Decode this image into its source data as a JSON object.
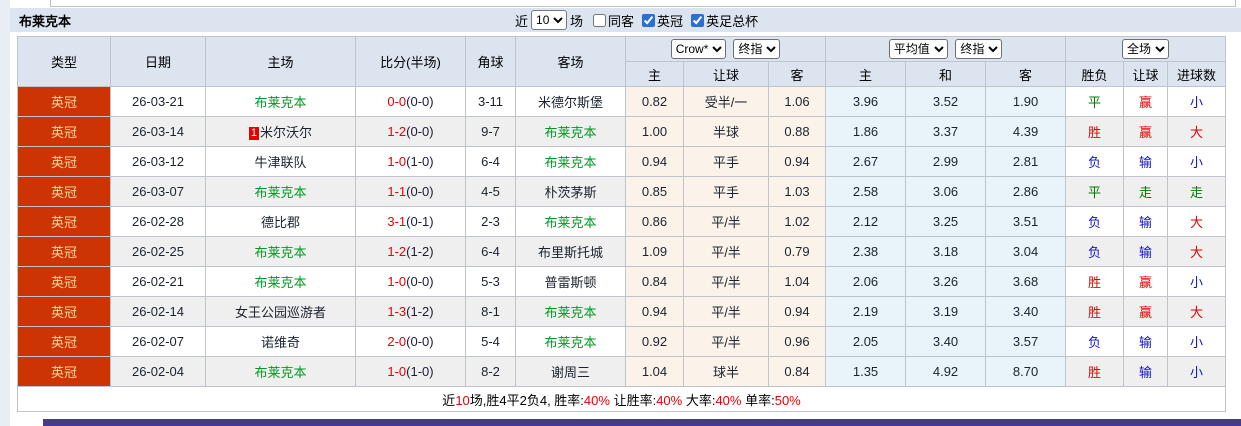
{
  "title": "布莱克本",
  "controls": {
    "recent_label": "近",
    "recent_value": "10",
    "matches_label": "场",
    "same_away": {
      "label": "同客",
      "checked": false
    },
    "league_filter": {
      "label": "英冠",
      "checked": true
    },
    "cup_filter": {
      "label": "英足总杯",
      "checked": true
    }
  },
  "dropdowns": {
    "bookmaker": "Crow*",
    "ah_final": "终指",
    "eu_avg": "平均值",
    "eu_final": "终指",
    "scope": "全场"
  },
  "columns": {
    "type": "类型",
    "date": "日期",
    "home": "主场",
    "score": "比分(半场)",
    "corners": "角球",
    "away": "客场",
    "ah_home": "主",
    "ah_line": "让球",
    "ah_away": "客",
    "eu_home": "主",
    "eu_draw": "和",
    "eu_away": "客",
    "wdl": "胜负",
    "handicap_result": "让球",
    "goals": "进球数"
  },
  "rows": [
    {
      "league": "英冠",
      "date": "26-03-21",
      "home": "布莱克本",
      "home_self": true,
      "home_badge": "",
      "score": "0-0",
      "half": "(0-0)",
      "corners": "3-11",
      "away": "米德尔斯堡",
      "away_self": false,
      "ah": [
        "0.82",
        "受半/一",
        "1.06"
      ],
      "eu": [
        "3.96",
        "3.52",
        "1.90"
      ],
      "results": [
        {
          "text": "平",
          "color": "green"
        },
        {
          "text": "赢",
          "color": "red"
        },
        {
          "text": "小",
          "color": "blue"
        }
      ]
    },
    {
      "league": "英冠",
      "date": "26-03-14",
      "home": "米尔沃尔",
      "home_self": false,
      "home_badge": "1",
      "score": "1-2",
      "half": "(0-0)",
      "corners": "9-7",
      "away": "布莱克本",
      "away_self": true,
      "ah": [
        "1.00",
        "半球",
        "0.88"
      ],
      "eu": [
        "1.86",
        "3.37",
        "4.39"
      ],
      "results": [
        {
          "text": "胜",
          "color": "red"
        },
        {
          "text": "赢",
          "color": "red"
        },
        {
          "text": "大",
          "color": "red"
        }
      ]
    },
    {
      "league": "英冠",
      "date": "26-03-12",
      "home": "牛津联队",
      "home_self": false,
      "home_badge": "",
      "score": "1-0",
      "half": "(1-0)",
      "corners": "6-4",
      "away": "布莱克本",
      "away_self": true,
      "ah": [
        "0.94",
        "平手",
        "0.94"
      ],
      "eu": [
        "2.67",
        "2.99",
        "2.81"
      ],
      "results": [
        {
          "text": "负",
          "color": "blue"
        },
        {
          "text": "输",
          "color": "blue"
        },
        {
          "text": "小",
          "color": "blue"
        }
      ]
    },
    {
      "league": "英冠",
      "date": "26-03-07",
      "home": "布莱克本",
      "home_self": true,
      "home_badge": "",
      "score": "1-1",
      "half": "(0-0)",
      "corners": "4-5",
      "away": "朴茨茅斯",
      "away_self": false,
      "ah": [
        "0.85",
        "平手",
        "1.03"
      ],
      "eu": [
        "2.58",
        "3.06",
        "2.86"
      ],
      "results": [
        {
          "text": "平",
          "color": "green"
        },
        {
          "text": "走",
          "color": "green"
        },
        {
          "text": "走",
          "color": "green"
        }
      ]
    },
    {
      "league": "英冠",
      "date": "26-02-28",
      "home": "德比郡",
      "home_self": false,
      "home_badge": "",
      "score": "3-1",
      "half": "(0-1)",
      "corners": "2-3",
      "away": "布莱克本",
      "away_self": true,
      "ah": [
        "0.86",
        "平/半",
        "1.02"
      ],
      "eu": [
        "2.12",
        "3.25",
        "3.51"
      ],
      "results": [
        {
          "text": "负",
          "color": "blue"
        },
        {
          "text": "输",
          "color": "blue"
        },
        {
          "text": "大",
          "color": "red"
        }
      ]
    },
    {
      "league": "英冠",
      "date": "26-02-25",
      "home": "布莱克本",
      "home_self": true,
      "home_badge": "",
      "score": "1-2",
      "half": "(1-2)",
      "corners": "6-4",
      "away": "布里斯托城",
      "away_self": false,
      "ah": [
        "1.09",
        "平/半",
        "0.79"
      ],
      "eu": [
        "2.38",
        "3.18",
        "3.04"
      ],
      "results": [
        {
          "text": "负",
          "color": "blue"
        },
        {
          "text": "输",
          "color": "blue"
        },
        {
          "text": "大",
          "color": "red"
        }
      ]
    },
    {
      "league": "英冠",
      "date": "26-02-21",
      "home": "布莱克本",
      "home_self": true,
      "home_badge": "",
      "score": "1-0",
      "half": "(0-0)",
      "corners": "5-3",
      "away": "普雷斯顿",
      "away_self": false,
      "ah": [
        "0.84",
        "平/半",
        "1.04"
      ],
      "eu": [
        "2.06",
        "3.26",
        "3.68"
      ],
      "results": [
        {
          "text": "胜",
          "color": "red"
        },
        {
          "text": "赢",
          "color": "red"
        },
        {
          "text": "小",
          "color": "blue"
        }
      ]
    },
    {
      "league": "英冠",
      "date": "26-02-14",
      "home": "女王公园巡游者",
      "home_self": false,
      "home_badge": "",
      "score": "1-3",
      "half": "(1-2)",
      "corners": "8-1",
      "away": "布莱克本",
      "away_self": true,
      "ah": [
        "0.94",
        "平/半",
        "0.94"
      ],
      "eu": [
        "2.19",
        "3.19",
        "3.40"
      ],
      "results": [
        {
          "text": "胜",
          "color": "red"
        },
        {
          "text": "赢",
          "color": "red"
        },
        {
          "text": "大",
          "color": "red"
        }
      ]
    },
    {
      "league": "英冠",
      "date": "26-02-07",
      "home": "诺维奇",
      "home_self": false,
      "home_badge": "",
      "score": "2-0",
      "half": "(0-0)",
      "corners": "5-4",
      "away": "布莱克本",
      "away_self": true,
      "ah": [
        "0.92",
        "平/半",
        "0.96"
      ],
      "eu": [
        "2.05",
        "3.40",
        "3.57"
      ],
      "results": [
        {
          "text": "负",
          "color": "blue"
        },
        {
          "text": "输",
          "color": "blue"
        },
        {
          "text": "小",
          "color": "blue"
        }
      ]
    },
    {
      "league": "英冠",
      "date": "26-02-04",
      "home": "布莱克本",
      "home_self": true,
      "home_badge": "",
      "score": "1-0",
      "half": "(1-0)",
      "corners": "8-2",
      "away": "谢周三",
      "away_self": false,
      "ah": [
        "1.04",
        "球半",
        "0.84"
      ],
      "eu": [
        "1.35",
        "4.92",
        "8.70"
      ],
      "results": [
        {
          "text": "胜",
          "color": "red"
        },
        {
          "text": "输",
          "color": "blue"
        },
        {
          "text": "小",
          "color": "blue"
        }
      ]
    }
  ],
  "footer": {
    "segments": [
      {
        "text": "近",
        "red": false
      },
      {
        "text": "10",
        "red": true
      },
      {
        "text": "场,胜4平2负4, 胜率:",
        "red": false
      },
      {
        "text": "40%",
        "red": true
      },
      {
        "text": " 让胜率:",
        "red": false
      },
      {
        "text": "40%",
        "red": true
      },
      {
        "text": " 大率:",
        "red": false
      },
      {
        "text": "40%",
        "red": true
      },
      {
        "text": " 单率:",
        "red": false
      },
      {
        "text": "50%",
        "red": true
      }
    ]
  },
  "colors": {
    "league_badge_bg": "#cc3503",
    "league_badge_text": "#ffd9a0",
    "self_team": "#009922",
    "win_red": "#e60000",
    "lose_blue": "#1212cc",
    "draw_green": "#007700",
    "header_bg": "#dbe4ef",
    "ah_bg": "#fbf3ea",
    "eu_bg": "#e9f3fa",
    "purple_bar": "#453a8e"
  }
}
